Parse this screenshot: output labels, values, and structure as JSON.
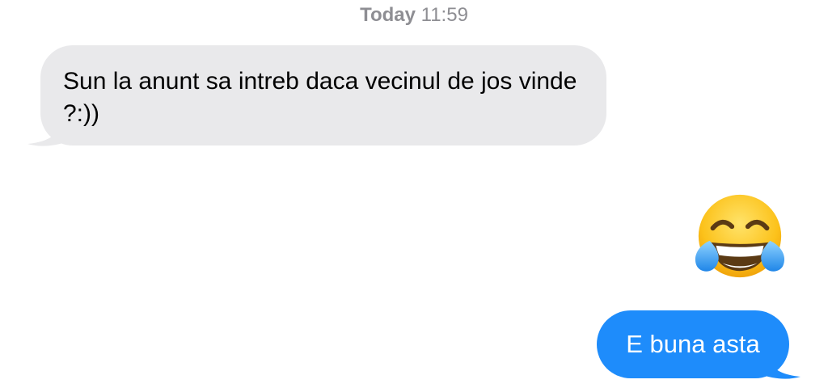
{
  "timestamp": {
    "day": "Today",
    "time": "11:59"
  },
  "messages": [
    {
      "direction": "incoming",
      "text": "Sun la anunt sa intreb daca vecinul de jos vinde ?:))"
    },
    {
      "direction": "outgoing",
      "type": "emoji",
      "emoji": "face-with-tears-of-joy"
    },
    {
      "direction": "outgoing",
      "text": "E buna asta"
    }
  ],
  "colors": {
    "incoming_bubble": "#e9e9eb",
    "outgoing_bubble": "#1e8cfb",
    "timestamp_text": "#8e8e93"
  }
}
